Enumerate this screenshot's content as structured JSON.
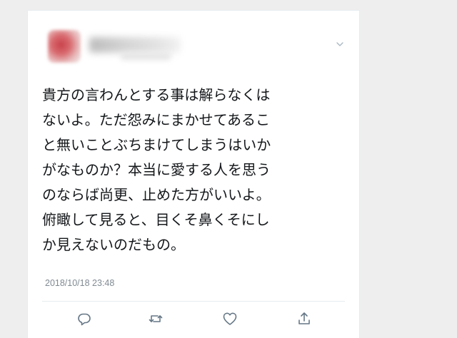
{
  "tweet": {
    "text": "貴方の言わんとする事は解らなくは\nないよ。ただ怨みにまかせてあるこ\nと無いことぶちまけてしまうはいか\nがなものか？本当に愛する人を思う\nのならば尚更、止めた方がいいよ。\n俯瞰して見ると、目くそ鼻くそにし\nか見えないのだもの。",
    "timestamp": "2018/10/18 23:48"
  },
  "icons": {
    "menu": "chevron-down-icon",
    "reply": "reply-icon",
    "retweet": "retweet-icon",
    "like": "heart-icon",
    "share": "share-icon"
  },
  "colors": {
    "text": "#14171a",
    "muted": "#808a93",
    "icon": "#657786",
    "divider": "#e6ecf0"
  }
}
